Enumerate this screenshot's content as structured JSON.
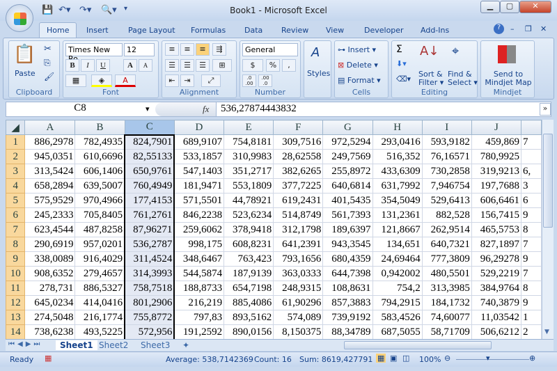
{
  "window": {
    "title": "Book1 - Microsoft Excel"
  },
  "quick_access": [
    "save-icon",
    "undo-icon",
    "redo-icon",
    "print-preview-icon",
    "customize-icon"
  ],
  "tabs": [
    "Home",
    "Insert",
    "Page Layout",
    "Formulas",
    "Data",
    "Review",
    "View",
    "Developer",
    "Add-Ins"
  ],
  "ribbon": {
    "clipboard": {
      "label": "Clipboard",
      "paste": "Paste"
    },
    "font": {
      "label": "Font",
      "name": "Times New Ro",
      "size": "12",
      "bold": "B",
      "italic": "I",
      "underline": "U",
      "grow": "A",
      "shrink": "A",
      "color": "A"
    },
    "alignment": {
      "label": "Alignment"
    },
    "number": {
      "label": "Number",
      "format": "General",
      "currency": "$",
      "percent": "%",
      "comma": ",",
      "inc": ".0 .00",
      "dec": ".00 .0"
    },
    "styles": {
      "label": "Styles"
    },
    "cells": {
      "label": "Cells",
      "insert": "Insert",
      "delete": "Delete",
      "format": "Format"
    },
    "editing": {
      "label": "Editing",
      "sum": "Σ",
      "sort1": "Sort &",
      "sort2": "Filter",
      "find1": "Find &",
      "find2": "Select"
    },
    "mindjet": {
      "label": "Mindjet",
      "send1": "Send to",
      "send2": "Mindjet Map"
    }
  },
  "formula_bar": {
    "name_box": "C8",
    "fx": "fx",
    "value": "536,27874443832"
  },
  "columns": [
    "A",
    "B",
    "C",
    "D",
    "E",
    "F",
    "G",
    "H",
    "I",
    "J",
    ""
  ],
  "selected_column": "C",
  "rows": [
    [
      "886,2978",
      "782,4935",
      "824,7901",
      "689,9107",
      "754,8181",
      "309,7516",
      "972,5294",
      "293,0416",
      "593,9182",
      "459,869",
      "7"
    ],
    [
      "945,0351",
      "610,6696",
      "82,55133",
      "533,1857",
      "310,9983",
      "28,62558",
      "249,7569",
      "516,352",
      "76,16571",
      "780,9925",
      ""
    ],
    [
      "313,5424",
      "606,1406",
      "650,9761",
      "547,1403",
      "351,2717",
      "382,6265",
      "255,8972",
      "433,6309",
      "730,2858",
      "319,9213",
      "6,"
    ],
    [
      "658,2894",
      "639,5007",
      "760,4949",
      "181,9471",
      "553,1809",
      "377,7225",
      "640,6814",
      "631,7992",
      "7,946754",
      "197,7688",
      "3"
    ],
    [
      "575,9529",
      "970,4966",
      "177,4153",
      "571,5501",
      "44,78921",
      "619,2431",
      "401,5435",
      "354,5049",
      "529,6413",
      "606,6461",
      "6"
    ],
    [
      "245,2333",
      "705,8405",
      "761,2761",
      "846,2238",
      "523,6234",
      "514,8749",
      "561,7393",
      "131,2361",
      "882,528",
      "156,7415",
      "9"
    ],
    [
      "623,4544",
      "487,8258",
      "87,96271",
      "259,6062",
      "378,9418",
      "312,1798",
      "189,6397",
      "121,8667",
      "262,9514",
      "465,5753",
      "8"
    ],
    [
      "290,6919",
      "957,0201",
      "536,2787",
      "998,175",
      "608,8231",
      "641,2391",
      "943,3545",
      "134,651",
      "640,7321",
      "827,1897",
      "7"
    ],
    [
      "338,0089",
      "916,4029",
      "311,4524",
      "348,6467",
      "763,423",
      "793,1656",
      "680,4359",
      "24,69464",
      "777,3809",
      "96,29278",
      "9"
    ],
    [
      "908,6352",
      "279,4657",
      "314,3993",
      "544,5874",
      "187,9139",
      "363,0333",
      "644,7398",
      "0,942002",
      "480,5501",
      "529,2219",
      "7"
    ],
    [
      "278,731",
      "886,5327",
      "758,7518",
      "188,8733",
      "654,7198",
      "248,9315",
      "108,8631",
      "754,2",
      "313,3985",
      "384,9764",
      "8"
    ],
    [
      "645,0234",
      "414,0416",
      "801,2906",
      "216,219",
      "885,4086",
      "61,90296",
      "857,3883",
      "794,2915",
      "184,1732",
      "740,3879",
      "9"
    ],
    [
      "274,5048",
      "216,1774",
      "755,8772",
      "797,83",
      "893,5162",
      "574,089",
      "739,9192",
      "583,4526",
      "74,60077",
      "11,03542",
      "1"
    ],
    [
      "738,6238",
      "493,5225",
      "572,956",
      "191,2592",
      "890,0156",
      "8,150375",
      "88,34789",
      "687,5055",
      "58,71709",
      "506,6212",
      "2"
    ]
  ],
  "sheets": [
    "Sheet1",
    "Sheet2",
    "Sheet3"
  ],
  "active_sheet": "Sheet1",
  "status": {
    "ready": "Ready",
    "average": "Average: 538,7142369",
    "count": "Count: 16",
    "sum": "Sum: 8619,427791",
    "zoom": "100%"
  }
}
